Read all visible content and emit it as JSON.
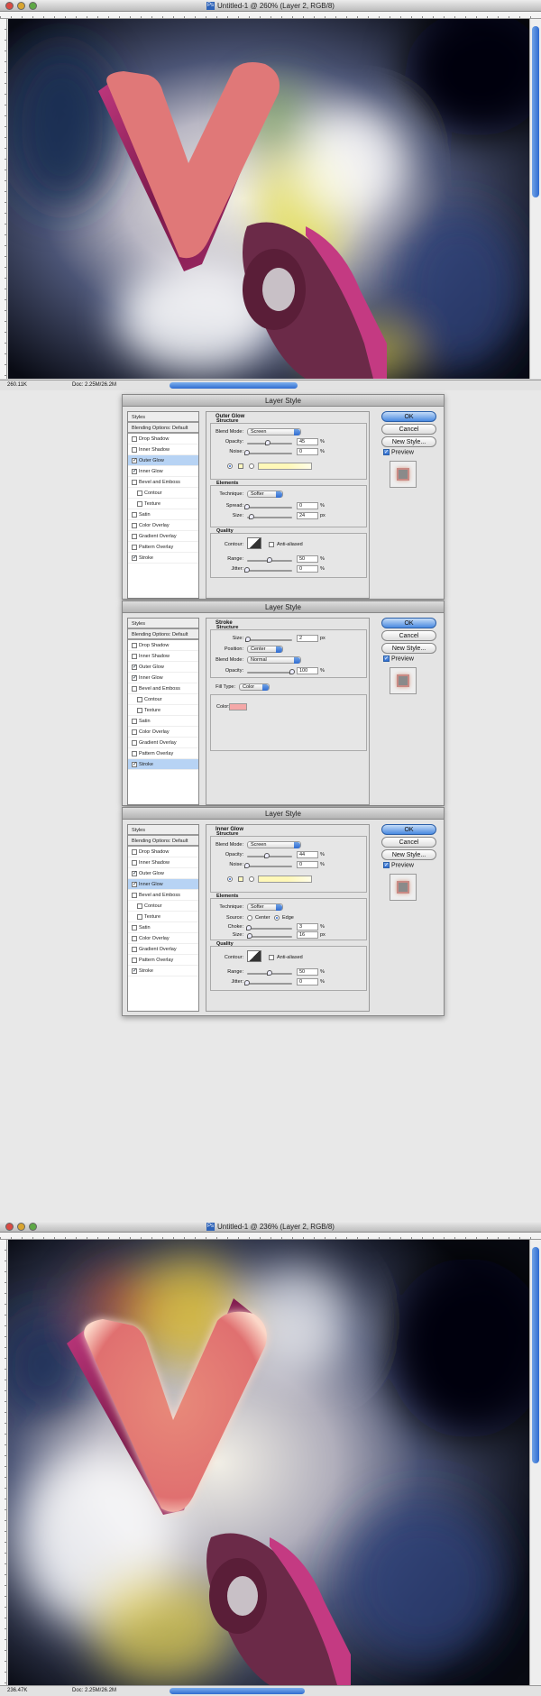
{
  "window1": {
    "title": "Untitled-1 @ 260% (Layer 2, RGB/8)",
    "zoom": "260.11K",
    "doc": "Doc: 2.25M/26.2M"
  },
  "window2": {
    "title": "Untitled-1 @ 236% (Layer 2, RGB/8)",
    "zoom": "236.47K",
    "doc": "Doc: 2.25M/26.2M"
  },
  "colors": {
    "accent": "#2f6bd0",
    "letter": "#e07878",
    "extrusion": "#9a2461"
  },
  "styles_list": [
    "Styles",
    "Blending Options: Default",
    "Drop Shadow",
    "Inner Shadow",
    "Outer Glow",
    "Inner Glow",
    "Bevel and Emboss",
    "Contour",
    "Texture",
    "Satin",
    "Color Overlay",
    "Gradient Overlay",
    "Pattern Overlay",
    "Stroke"
  ],
  "dialog_title": "Layer Style",
  "buttons": {
    "ok": "OK",
    "cancel": "Cancel",
    "new_style": "New Style...",
    "preview": "Preview"
  },
  "common": {
    "structure": "Structure",
    "elements": "Elements",
    "quality": "Quality",
    "blend_mode": "Blend Mode:",
    "opacity": "Opacity:",
    "noise": "Noise:",
    "technique": "Technique:",
    "size": "Size:",
    "contour": "Contour:",
    "anti_aliased": "Anti-aliased",
    "range": "Range:",
    "jitter": "Jitter:",
    "pct": "%",
    "px": "px"
  },
  "outer_glow": {
    "title": "Outer Glow",
    "blend": "Screen",
    "opacity": "45",
    "noise": "0",
    "technique": "Softer",
    "spread_label": "Spread:",
    "spread": "0",
    "size": "24",
    "range": "50",
    "jitter": "0"
  },
  "stroke": {
    "title": "Stroke",
    "size": "2",
    "position_label": "Position:",
    "position": "Center",
    "blend": "Normal",
    "opacity": "100",
    "fill_type_label": "Fill Type:",
    "fill_type": "Color",
    "color_label": "Color:"
  },
  "inner_glow": {
    "title": "Inner Glow",
    "blend": "Screen",
    "opacity": "44",
    "noise": "0",
    "technique": "Softer",
    "source_label": "Source:",
    "center": "Center",
    "edge": "Edge",
    "choke_label": "Choke:",
    "choke": "3",
    "size": "16",
    "range": "50",
    "jitter": "0"
  }
}
